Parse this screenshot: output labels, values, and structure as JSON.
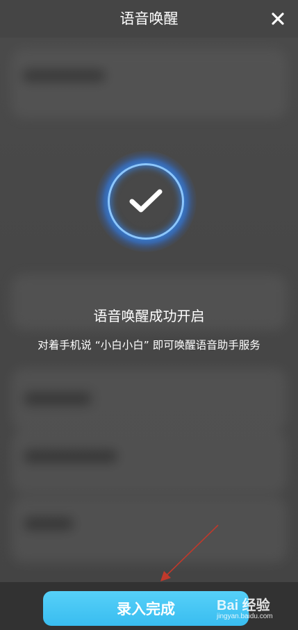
{
  "header": {
    "title": "语音唤醒",
    "close_icon": "close-icon"
  },
  "badge": {
    "icon": "checkmark-icon",
    "ring_color": "#8cc7ff",
    "glow_color": "#2f86ff"
  },
  "message": {
    "title": "语音唤醒成功开启",
    "hint": "对着手机说 “小白小白” 即可唤醒语音助手服务"
  },
  "footer": {
    "finish_label": "录入完成",
    "button_color": "#45c6f4"
  },
  "watermark": {
    "brand": "Bai 经验",
    "url": "jingyan.baidu.com"
  },
  "annotation": {
    "arrow_color": "#c0392b"
  }
}
